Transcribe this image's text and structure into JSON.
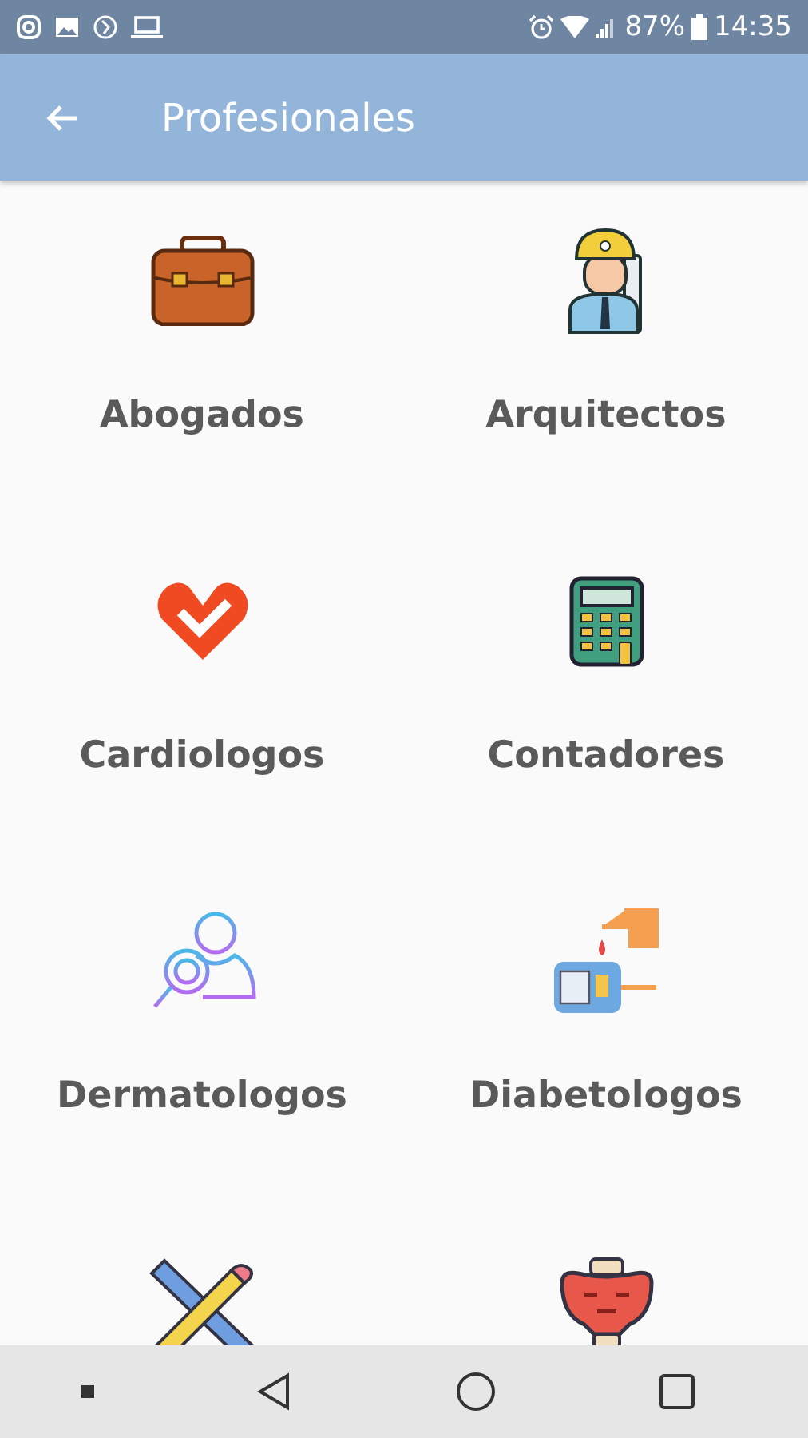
{
  "status_bar": {
    "battery": "87%",
    "time": "14:35"
  },
  "app_bar": {
    "title": "Profesionales"
  },
  "items": [
    {
      "kind": "briefcase",
      "label": "Abogados"
    },
    {
      "kind": "engineer",
      "label": "Arquitectos"
    },
    {
      "kind": "heart",
      "label": "Cardiologos"
    },
    {
      "kind": "calculator",
      "label": "Contadores"
    },
    {
      "kind": "dermatologist",
      "label": "Dermatologos"
    },
    {
      "kind": "glucometer",
      "label": "Diabetologos"
    },
    {
      "kind": "ruler-pencil"
    },
    {
      "kind": "pelvis"
    }
  ]
}
